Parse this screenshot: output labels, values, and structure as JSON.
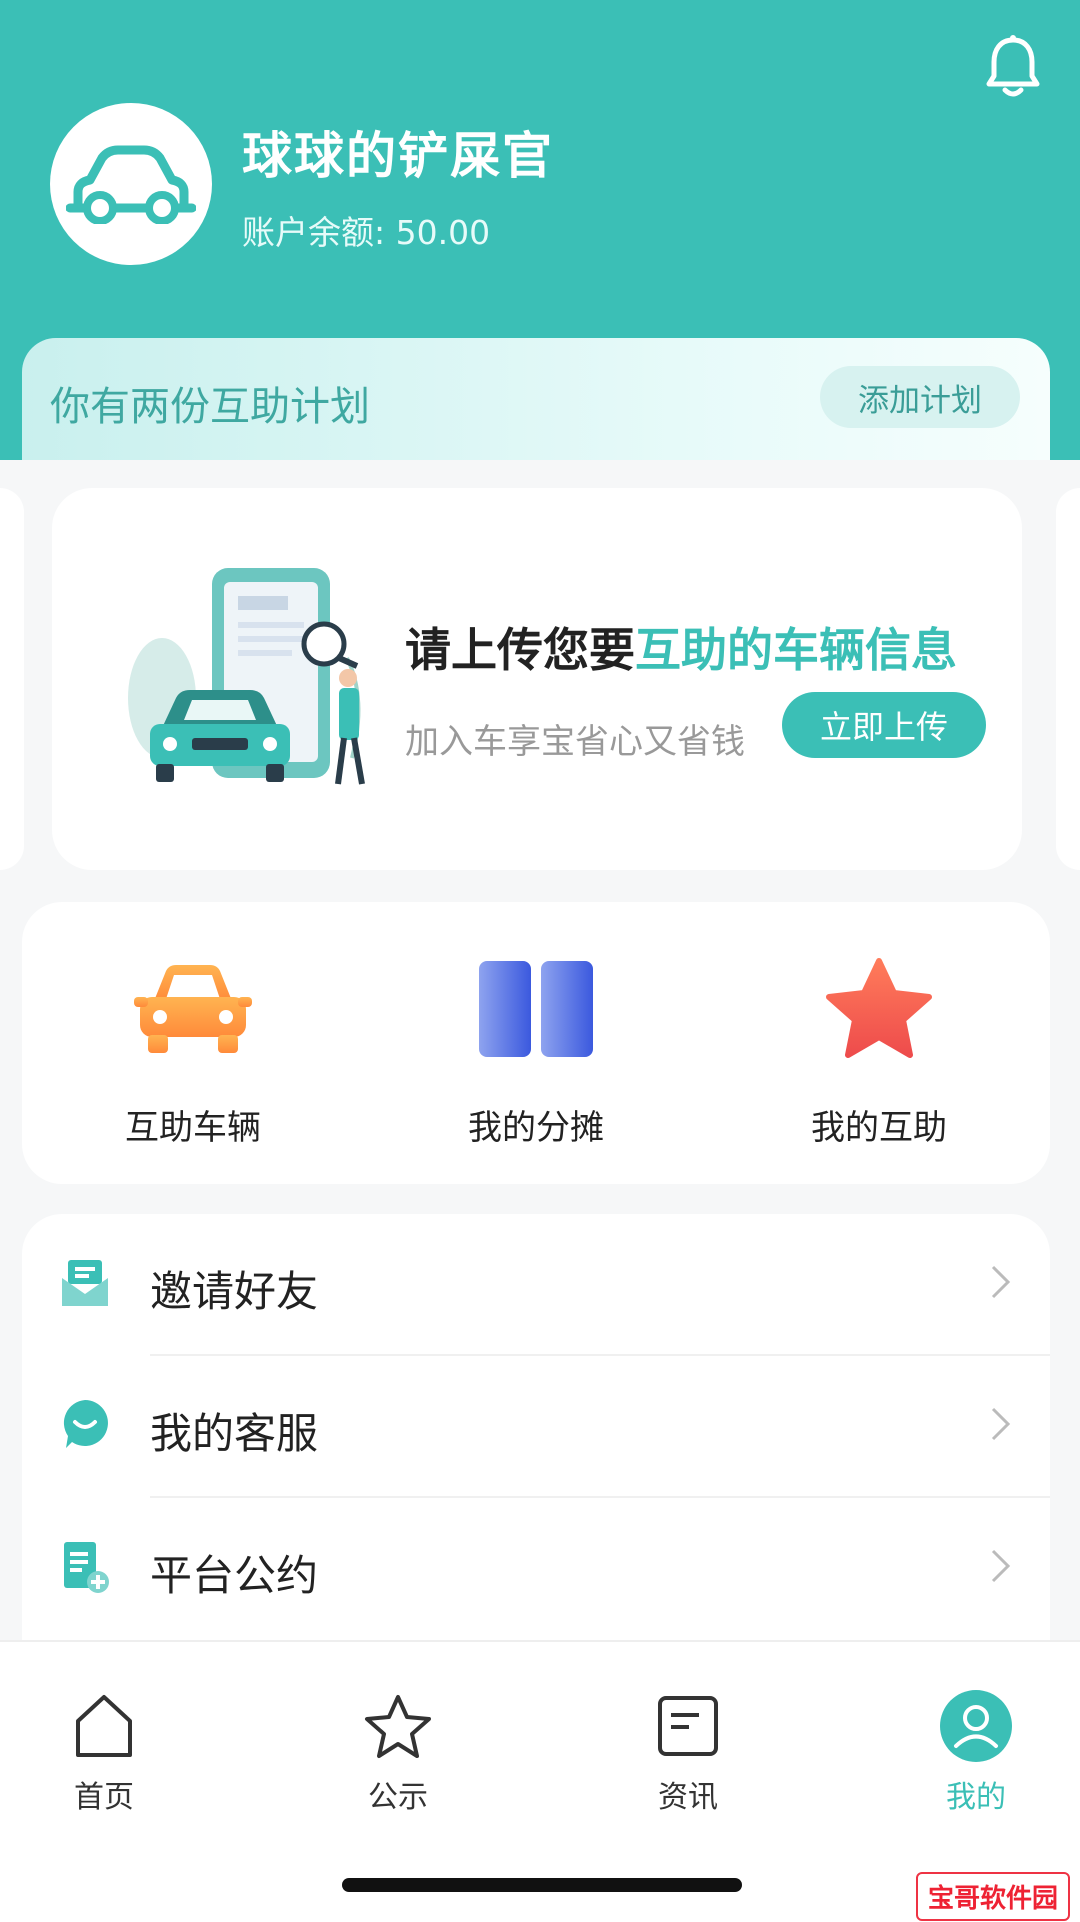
{
  "profile": {
    "username": "球球的铲屎官",
    "balance_label": "账户余额: 50.00"
  },
  "plan_banner": {
    "text": "你有两份互助计划",
    "button": "添加计划"
  },
  "upload_card": {
    "title_prefix": "请上传您要",
    "title_highlight": "互助的车辆信息",
    "subtitle": "加入车享宝省心又省钱",
    "button": "立即上传"
  },
  "quick_actions": [
    {
      "label": "互助车辆",
      "icon": "orange-car-icon"
    },
    {
      "label": "我的分摊",
      "icon": "blue-split-icon"
    },
    {
      "label": "我的互助",
      "icon": "red-star-icon"
    }
  ],
  "menu": [
    {
      "label": "邀请好友",
      "icon": "envelope-icon"
    },
    {
      "label": "我的客服",
      "icon": "chat-bubble-icon"
    },
    {
      "label": "平台公约",
      "icon": "document-add-icon"
    }
  ],
  "tabs": [
    {
      "label": "首页",
      "icon": "home-icon",
      "active": false
    },
    {
      "label": "公示",
      "icon": "star-outline-icon",
      "active": false
    },
    {
      "label": "资讯",
      "icon": "news-icon",
      "active": false
    },
    {
      "label": "我的",
      "icon": "user-icon",
      "active": true
    }
  ],
  "watermark": "宝哥软件园",
  "colors": {
    "primary": "#3bbfb6",
    "accent_orange": "#ff9a3c",
    "accent_blue": "#4a6fe0",
    "accent_red": "#f2544f"
  }
}
